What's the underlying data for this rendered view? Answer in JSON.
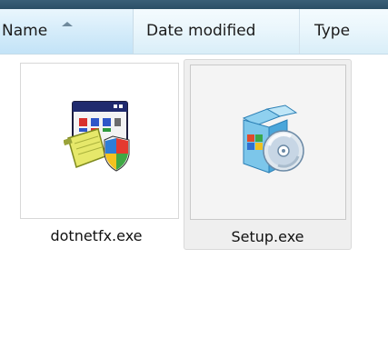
{
  "header": {
    "columns": [
      {
        "label": "Name"
      },
      {
        "label": "Date modified"
      },
      {
        "label": "Type"
      }
    ]
  },
  "files": [
    {
      "name": "dotnetfx.exe",
      "icon": "installer-shield-icon"
    },
    {
      "name": "Setup.exe",
      "icon": "setup-box-disc-icon"
    }
  ]
}
